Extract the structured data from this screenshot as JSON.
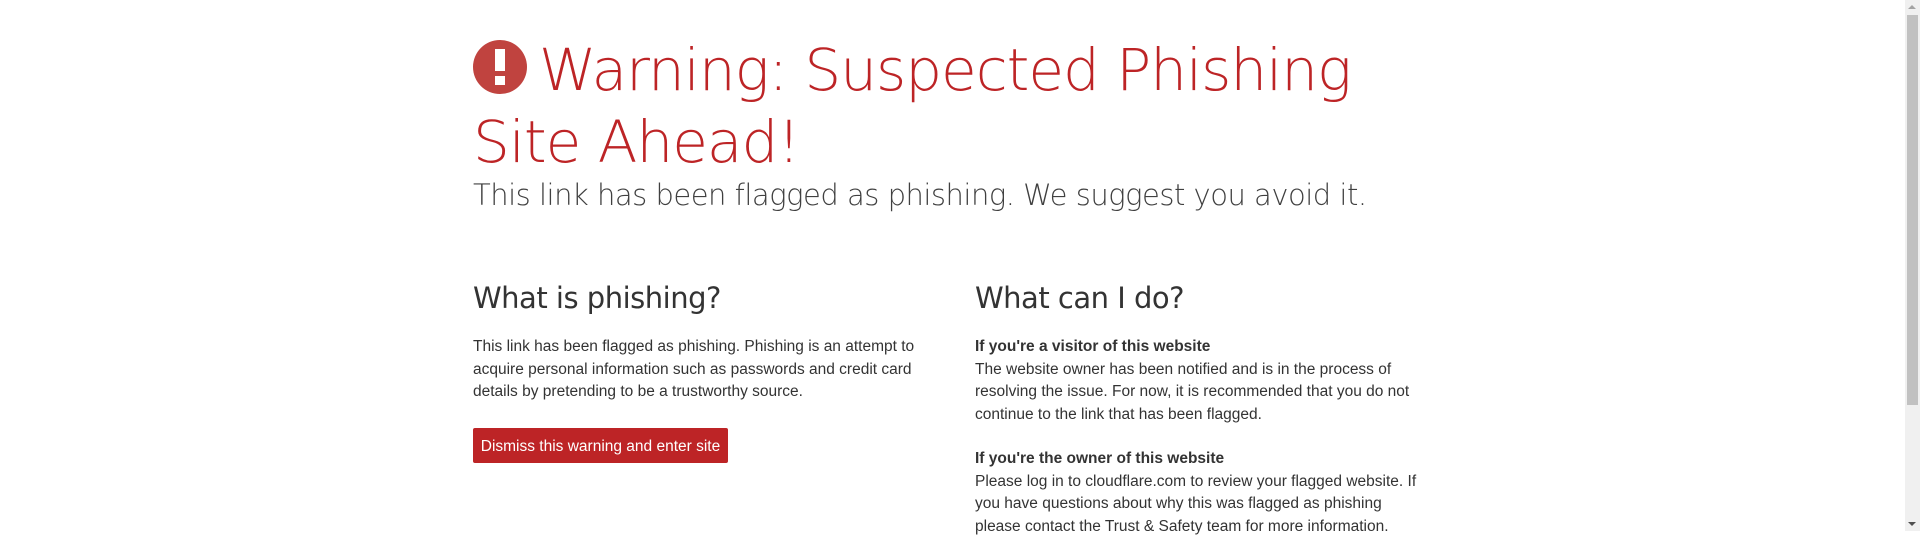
{
  "header": {
    "title": "Warning: Suspected Phishing Site Ahead!",
    "subtitle": "This link has been flagged as phishing. We suggest you avoid it.",
    "icon": "exclamation-circle-icon",
    "accent": "#bd2426"
  },
  "left": {
    "heading": "What is phishing?",
    "body": "This link has been flagged as phishing. Phishing is an attempt to acquire personal information such as passwords and credit card details by pretending to be a trustworthy source.",
    "button": "Dismiss this warning and enter site"
  },
  "right": {
    "heading": "What can I do?",
    "visitor_title": "If you're a visitor of this website",
    "visitor_body": "The website owner has been notified and is in the process of resolving the issue. For now, it is recommended that you do not continue to the link that has been flagged.",
    "owner_title": "If you're the owner of this website",
    "owner_body": "Please log in to cloudflare.com to review your flagged website. If you have questions about why this was flagged as phishing please contact the Trust & Safety team for more information."
  }
}
